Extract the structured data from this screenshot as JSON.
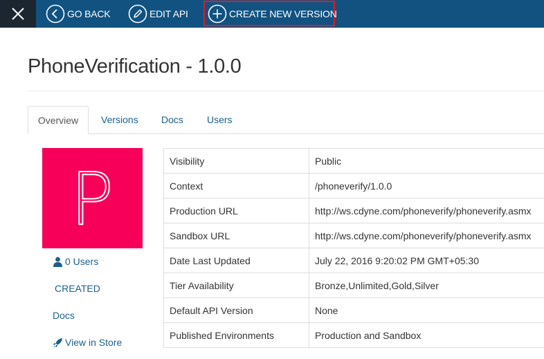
{
  "toolbar": {
    "go_back_label": "GO BACK",
    "edit_api_label": "EDIT API",
    "create_new_version_label": "CREATE NEW VERSION",
    "highlight_color": "#e11b22",
    "background_color": "#115281"
  },
  "page": {
    "title": "PhoneVerification - 1.0.0"
  },
  "tabs": [
    {
      "label": "Overview",
      "active": true
    },
    {
      "label": "Versions",
      "active": false
    },
    {
      "label": "Docs",
      "active": false
    },
    {
      "label": "Users",
      "active": false
    }
  ],
  "sidebar": {
    "thumbnail_letter": "P",
    "thumbnail_color": "#f7005a",
    "users_label": "0 Users",
    "status_label": "CREATED",
    "docs_label": "Docs",
    "store_label": "View in Store"
  },
  "details": [
    {
      "key": "Visibility",
      "value": "Public"
    },
    {
      "key": "Context",
      "value": "/phoneverify/1.0.0"
    },
    {
      "key": "Production URL",
      "value": "http://ws.cdyne.com/phoneverify/phoneverify.asmx"
    },
    {
      "key": "Sandbox URL",
      "value": "http://ws.cdyne.com/phoneverify/phoneverify.asmx"
    },
    {
      "key": "Date Last Updated",
      "value": "July 22, 2016 9:20:02 PM GMT+05:30"
    },
    {
      "key": "Tier Availability",
      "value": "Bronze,Unlimited,Gold,Silver"
    },
    {
      "key": "Default API Version",
      "value": "None"
    },
    {
      "key": "Published Environments",
      "value": "Production and Sandbox"
    }
  ]
}
